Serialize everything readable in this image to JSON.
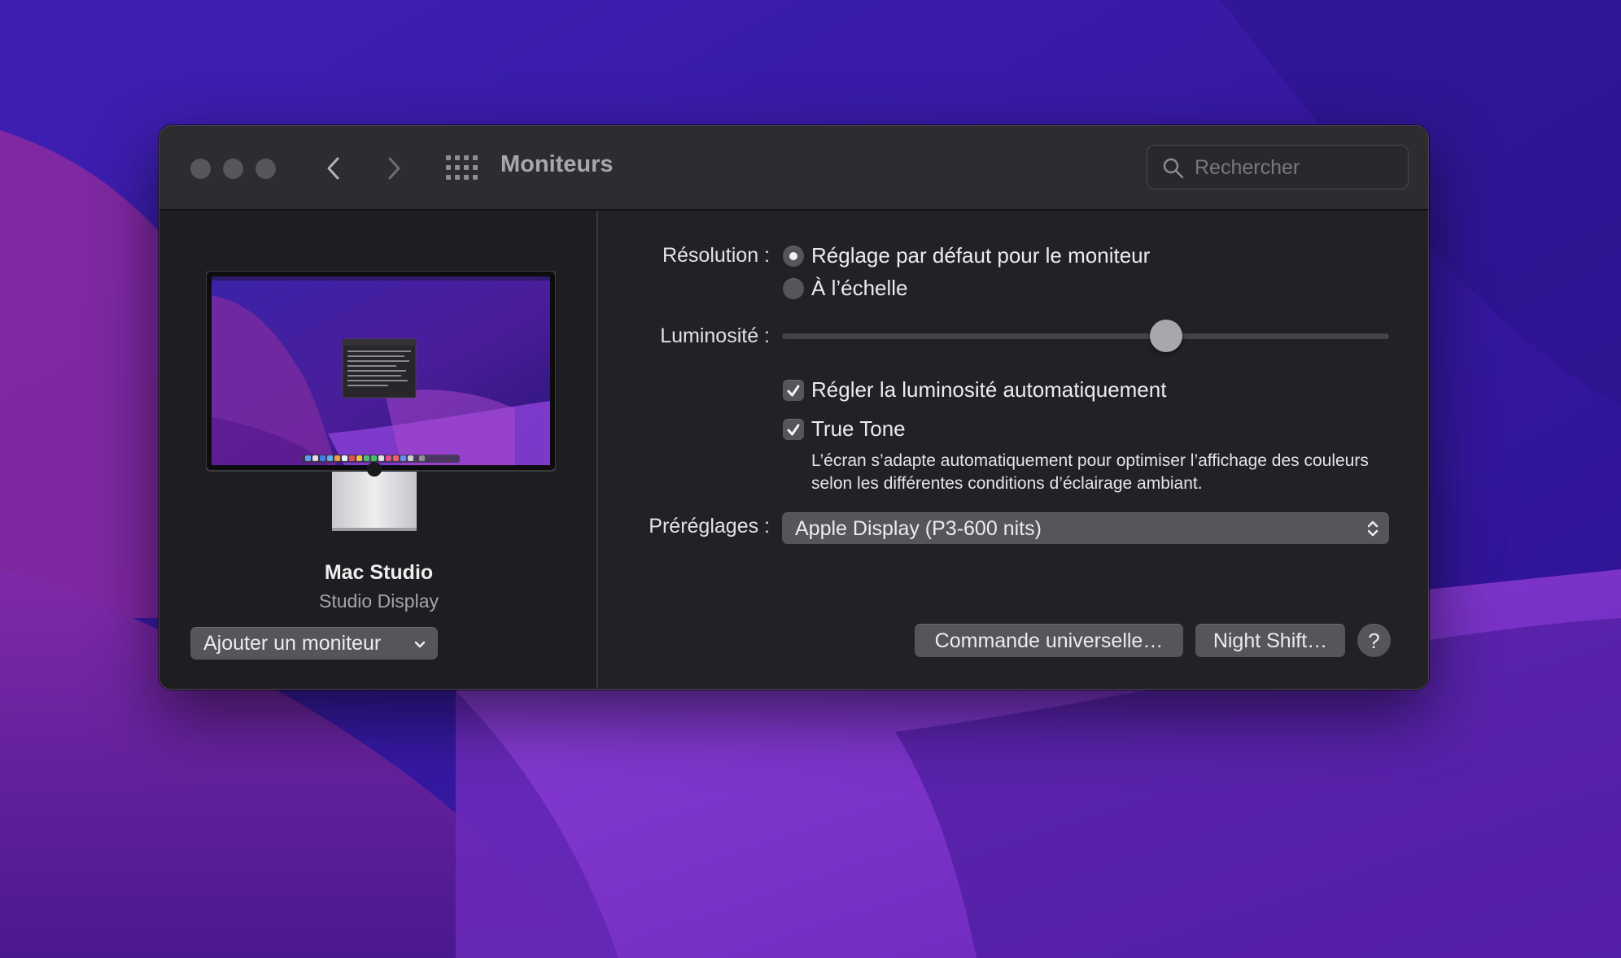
{
  "window": {
    "title": "Moniteurs",
    "search_placeholder": "Rechercher"
  },
  "sidebar": {
    "device_name": "Mac Studio",
    "device_model": "Studio Display",
    "add_monitor_label": "Ajouter un moniteur"
  },
  "settings": {
    "resolution_label": "Résolution :",
    "resolution_options": [
      {
        "label": "Réglage par défaut pour le moniteur",
        "selected": true
      },
      {
        "label": "À l’échelle",
        "selected": false
      }
    ],
    "brightness_label": "Luminosité :",
    "brightness_value": 0.64,
    "auto_brightness_label": "Régler la luminosité automatiquement",
    "auto_brightness_checked": true,
    "true_tone_label": "True Tone",
    "true_tone_checked": true,
    "true_tone_description": "L’écran s’adapte automatiquement pour optimiser l’affichage des couleurs selon les différentes conditions d’éclairage ambiant.",
    "presets_label": "Préréglages :",
    "presets_value": "Apple Display (P3-600 nits)"
  },
  "footer": {
    "universal_control_label": "Commande universelle…",
    "night_shift_label": "Night Shift…",
    "help_label": "?"
  },
  "colors": {
    "window_bg": "#232126",
    "control_bg": "#57555b",
    "wallpaper_primary": "#3a1aa8",
    "wallpaper_accent": "#8a3bd0"
  }
}
